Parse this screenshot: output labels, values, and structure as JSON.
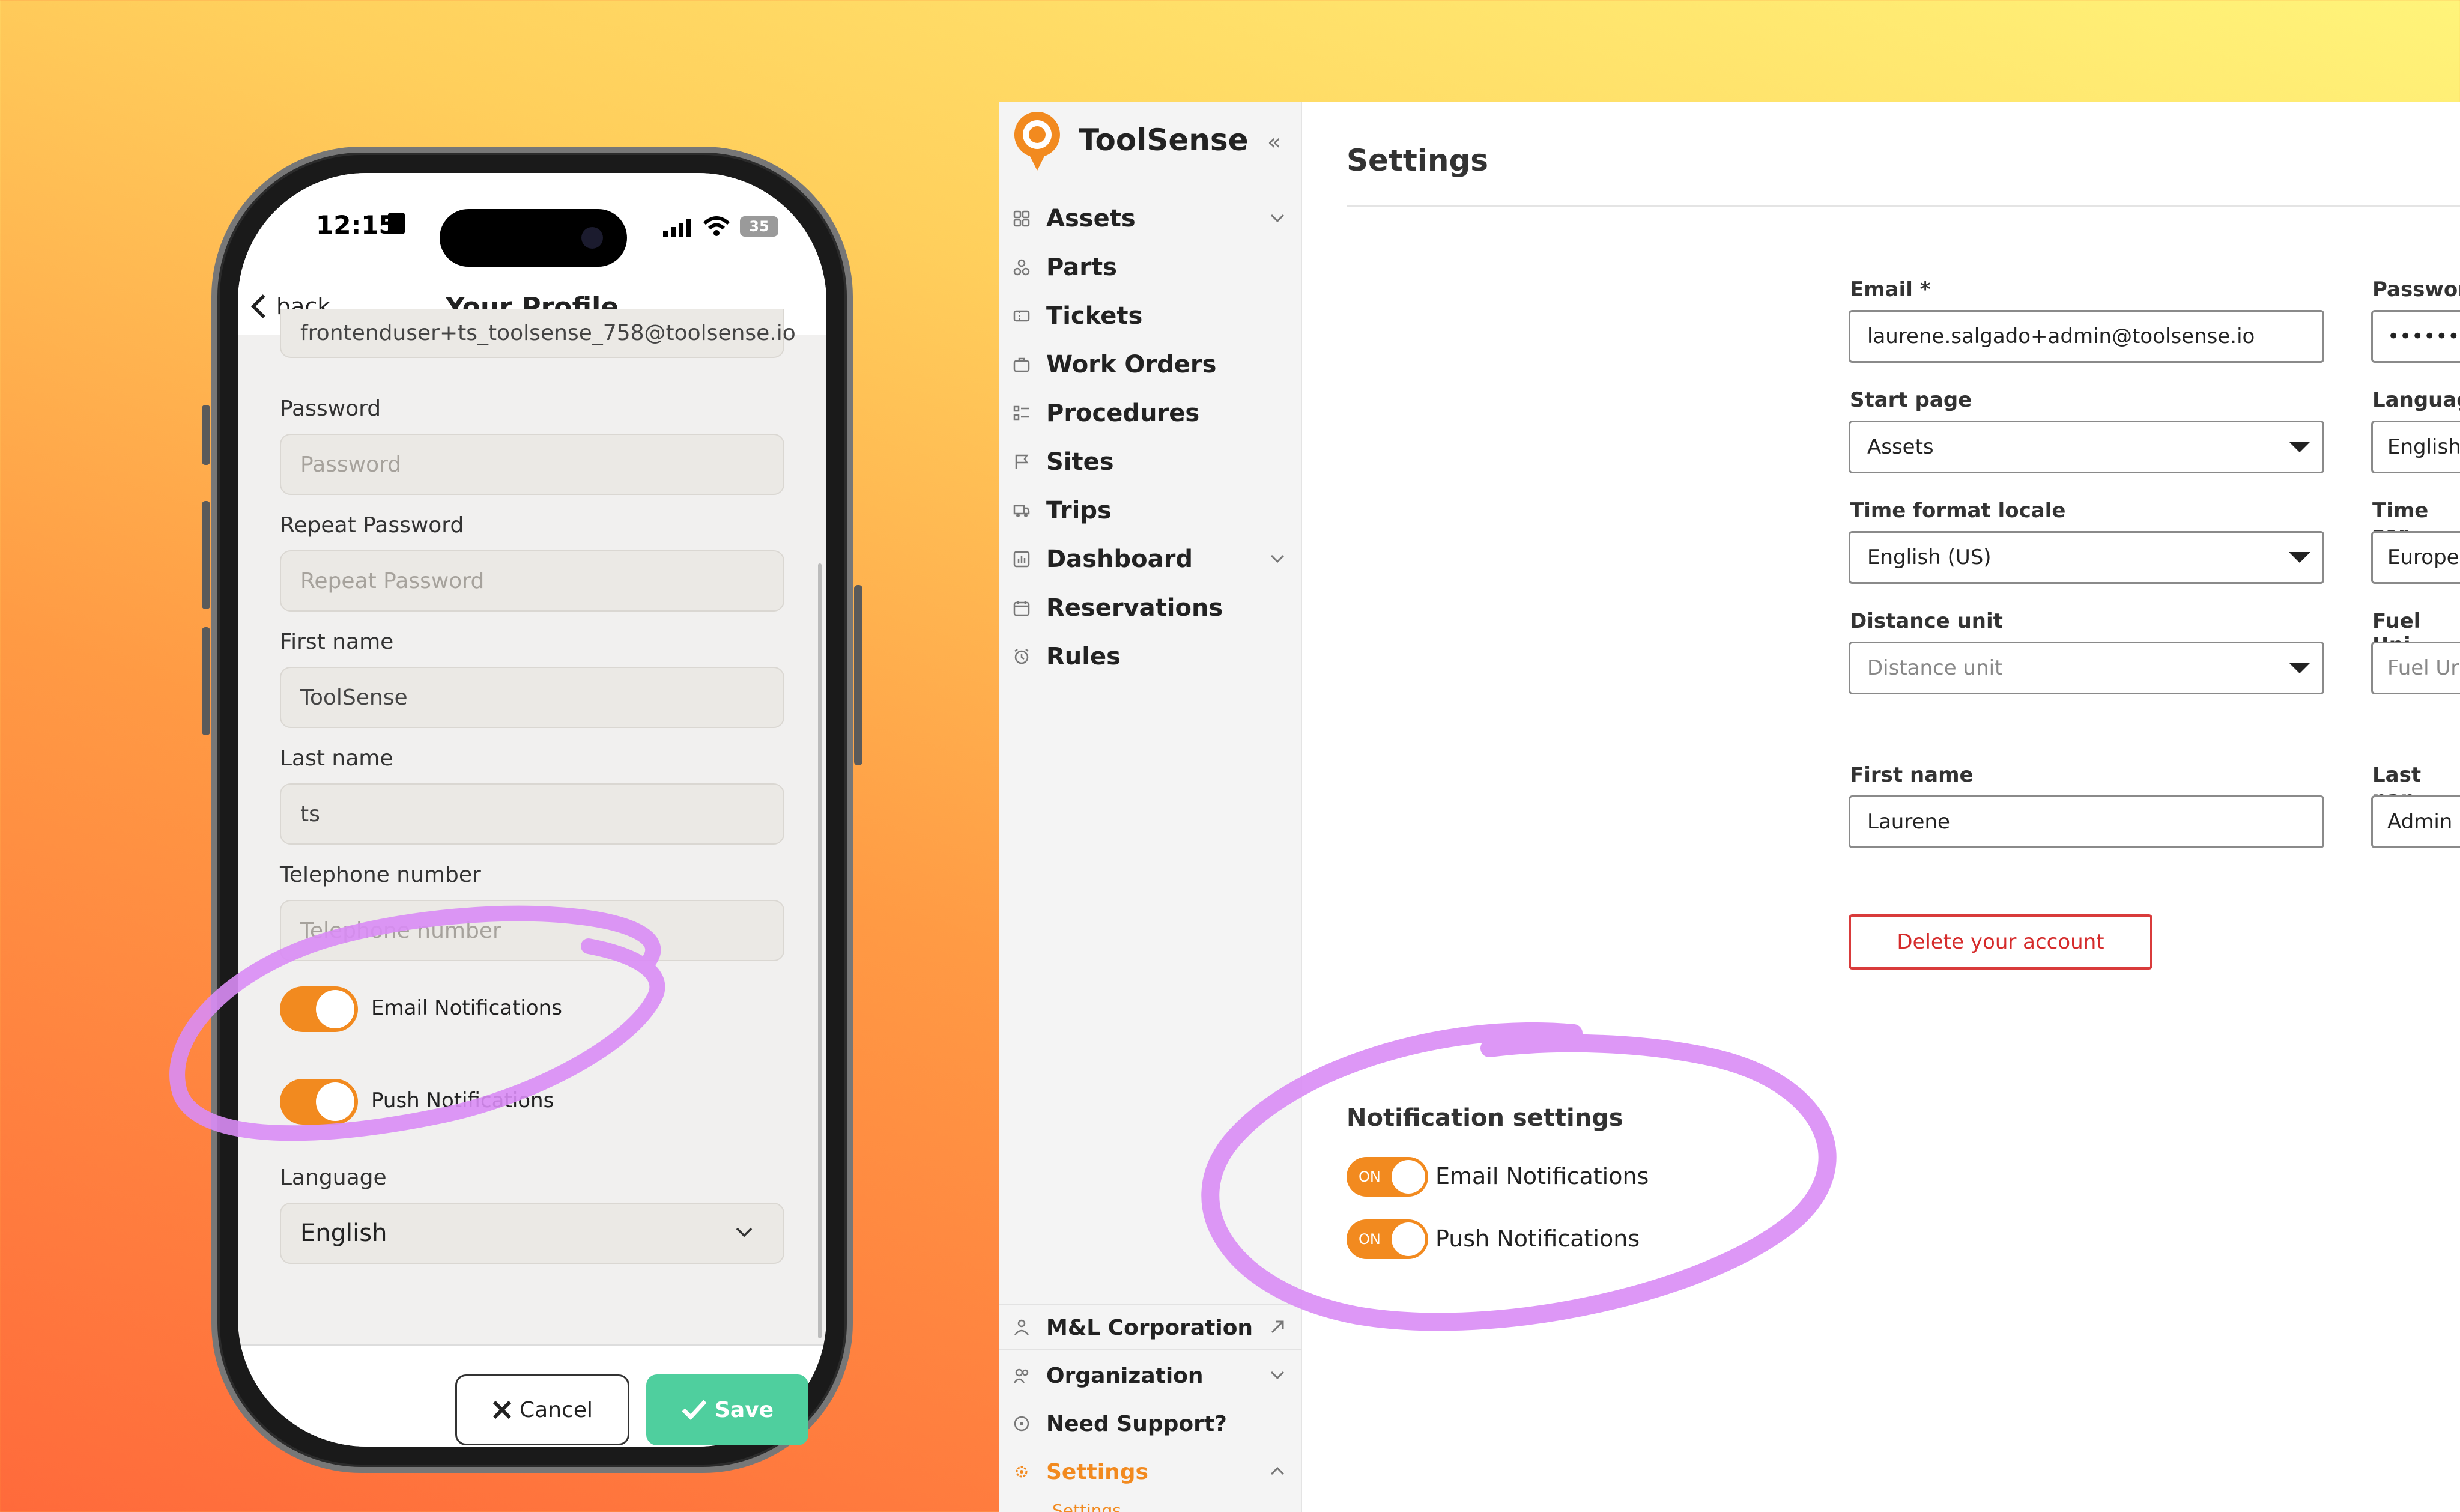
{
  "colors": {
    "accent": "#f28a1f",
    "save": "#4fcf9e",
    "danger": "#d52b2b",
    "highlight": "#d98cf5"
  },
  "phone": {
    "status": {
      "time": "12:15",
      "battery": "35"
    },
    "header": {
      "back": "back",
      "title": "Your Profile"
    },
    "email_value": "frontenduser+ts_toolsense_758@toolsense.io",
    "fields": [
      {
        "label": "Password",
        "placeholder": "Password",
        "value": ""
      },
      {
        "label": "Repeat Password",
        "placeholder": "Repeat Password",
        "value": ""
      },
      {
        "label": "First name",
        "value": "ToolSense"
      },
      {
        "label": "Last name",
        "value": "ts"
      },
      {
        "label": "Telephone number",
        "placeholder": "Telephone number",
        "value": ""
      }
    ],
    "toggles": [
      {
        "label": "Email Notifications",
        "on": true
      },
      {
        "label": "Push Notifications",
        "on": true
      }
    ],
    "language": {
      "label": "Language",
      "value": "English"
    },
    "footer": {
      "cancel": "Cancel",
      "save": "Save"
    }
  },
  "web": {
    "brand": "ToolSense",
    "nav": [
      {
        "label": "Assets",
        "icon": "grid-icon",
        "expandable": true
      },
      {
        "label": "Parts",
        "icon": "parts-icon",
        "expandable": false
      },
      {
        "label": "Tickets",
        "icon": "ticket-icon",
        "expandable": false
      },
      {
        "label": "Work Orders",
        "icon": "briefcase-icon",
        "expandable": false
      },
      {
        "label": "Procedures",
        "icon": "list-icon",
        "expandable": false
      },
      {
        "label": "Sites",
        "icon": "flag-icon",
        "expandable": false
      },
      {
        "label": "Trips",
        "icon": "truck-icon",
        "expandable": false
      },
      {
        "label": "Dashboard",
        "icon": "chart-icon",
        "expandable": true
      },
      {
        "label": "Reservations",
        "icon": "calendar-icon",
        "expandable": false
      },
      {
        "label": "Rules",
        "icon": "alarm-icon",
        "expandable": false
      }
    ],
    "lower_nav": [
      {
        "label": "M&L Corporation",
        "icon": "company-icon"
      },
      {
        "label": "Organization",
        "icon": "people-icon"
      },
      {
        "label": "Need Support?",
        "icon": "help-icon"
      },
      {
        "label": "Settings",
        "icon": "gear-icon"
      }
    ],
    "settings_sub": "Settings",
    "title": "Settings",
    "form": {
      "email": {
        "label": "Email *",
        "value": "laurene.salgado+admin@toolsense.io"
      },
      "password": {
        "label": "Passwor",
        "value": "•••••••••"
      },
      "start_page": {
        "label": "Start page",
        "value": "Assets"
      },
      "language": {
        "label": "Languag",
        "value": "English"
      },
      "time_format": {
        "label": "Time format locale",
        "value": "English (US)"
      },
      "time_zone": {
        "label": "Time zor",
        "value": "Europe"
      },
      "distance": {
        "label": "Distance unit",
        "placeholder": "Distance unit"
      },
      "fuel": {
        "label": "Fuel Uni",
        "placeholder": "Fuel Ur"
      },
      "first_name": {
        "label": "First name",
        "value": "Laurene"
      },
      "last_name": {
        "label": "Last nan",
        "value": "Admin"
      },
      "delete": "Delete your account"
    },
    "notifications": {
      "title": "Notification settings",
      "on_label": "ON",
      "items": [
        {
          "label": "Email Notifications",
          "on": true
        },
        {
          "label": "Push Notifications",
          "on": true
        }
      ]
    }
  }
}
